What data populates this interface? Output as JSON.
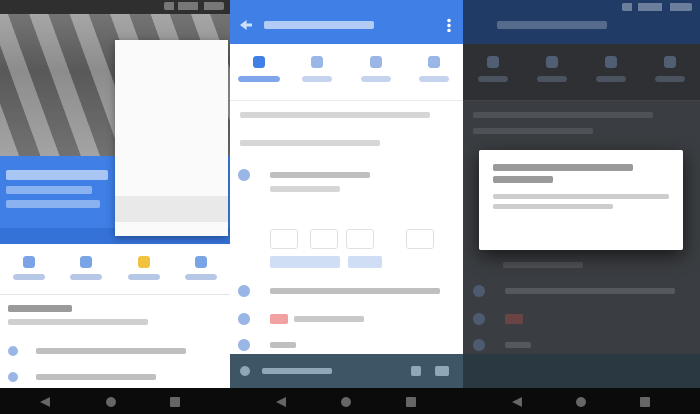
{
  "panels": {
    "p1": {
      "menu_items": [
        "",
        "",
        "",
        "",
        "",
        "",
        ""
      ]
    },
    "p2": {
      "chips": [
        "",
        "",
        "",
        ""
      ]
    },
    "p3": {
      "dialog": {
        "cancel_label": "",
        "confirm_label": ""
      }
    }
  },
  "colors": {
    "accent": "#3f7fe6",
    "appbar_dark": "#1f3b66",
    "bottomsheet": "#3e5566"
  },
  "icons": [
    "back-icon",
    "home-icon",
    "recents-icon",
    "more-icon"
  ]
}
